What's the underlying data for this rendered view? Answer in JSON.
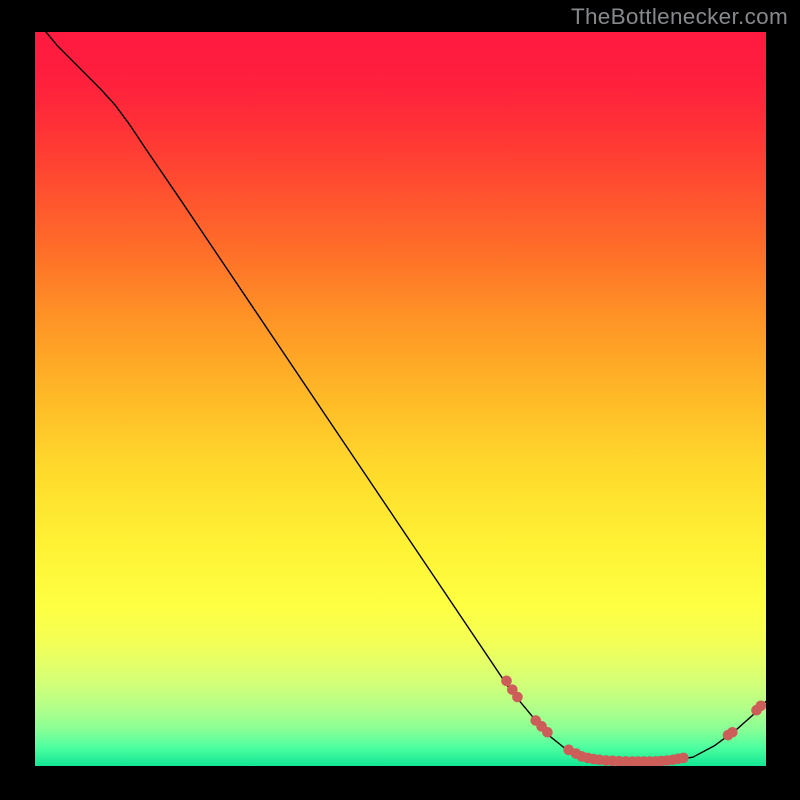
{
  "attribution": "TheBottlenecker.com",
  "chart_data": {
    "type": "line",
    "title": "",
    "xlabel": "",
    "ylabel": "",
    "xlim": [
      0,
      100
    ],
    "ylim": [
      0,
      100
    ],
    "background_gradient": {
      "stops": [
        {
          "offset": 0.0,
          "color": "#ff1a40"
        },
        {
          "offset": 0.06,
          "color": "#ff1e3e"
        },
        {
          "offset": 0.12,
          "color": "#ff2e38"
        },
        {
          "offset": 0.2,
          "color": "#ff4a30"
        },
        {
          "offset": 0.3,
          "color": "#ff6f29"
        },
        {
          "offset": 0.4,
          "color": "#ff9726"
        },
        {
          "offset": 0.5,
          "color": "#ffba27"
        },
        {
          "offset": 0.6,
          "color": "#ffdb2c"
        },
        {
          "offset": 0.7,
          "color": "#fff235"
        },
        {
          "offset": 0.78,
          "color": "#feff41"
        },
        {
          "offset": 0.83,
          "color": "#f4ff55"
        },
        {
          "offset": 0.86,
          "color": "#e4ff68"
        },
        {
          "offset": 0.89,
          "color": "#d0ff79"
        },
        {
          "offset": 0.92,
          "color": "#b3ff89"
        },
        {
          "offset": 0.95,
          "color": "#89ff95"
        },
        {
          "offset": 0.975,
          "color": "#4dffa0"
        },
        {
          "offset": 1.0,
          "color": "#12e695"
        }
      ]
    },
    "curve": {
      "color": "#000000",
      "width": 1.4,
      "points": [
        {
          "x": 1.5,
          "y": 100.0
        },
        {
          "x": 3.0,
          "y": 98.2
        },
        {
          "x": 6.0,
          "y": 95.2
        },
        {
          "x": 9.0,
          "y": 92.2
        },
        {
          "x": 11.0,
          "y": 90.0
        },
        {
          "x": 13.0,
          "y": 87.3
        },
        {
          "x": 15.0,
          "y": 84.3
        },
        {
          "x": 20.0,
          "y": 77.0
        },
        {
          "x": 25.0,
          "y": 69.6
        },
        {
          "x": 30.0,
          "y": 62.2
        },
        {
          "x": 35.0,
          "y": 54.8
        },
        {
          "x": 40.0,
          "y": 47.4
        },
        {
          "x": 45.0,
          "y": 40.0
        },
        {
          "x": 50.0,
          "y": 32.6
        },
        {
          "x": 55.0,
          "y": 25.2
        },
        {
          "x": 60.0,
          "y": 17.8
        },
        {
          "x": 65.0,
          "y": 10.4
        },
        {
          "x": 70.0,
          "y": 4.4
        },
        {
          "x": 72.5,
          "y": 2.4
        },
        {
          "x": 75.0,
          "y": 1.2
        },
        {
          "x": 78.0,
          "y": 0.6
        },
        {
          "x": 82.0,
          "y": 0.6
        },
        {
          "x": 86.0,
          "y": 0.6
        },
        {
          "x": 90.0,
          "y": 1.2
        },
        {
          "x": 93.0,
          "y": 2.8
        },
        {
          "x": 96.0,
          "y": 5.0
        },
        {
          "x": 98.5,
          "y": 7.2
        },
        {
          "x": 100.0,
          "y": 8.8
        }
      ]
    },
    "markers": {
      "color": "#cd5d58",
      "radius": 5.3,
      "points": [
        {
          "x": 64.5,
          "y": 11.6
        },
        {
          "x": 65.3,
          "y": 10.4
        },
        {
          "x": 66.0,
          "y": 9.4
        },
        {
          "x": 68.5,
          "y": 6.2
        },
        {
          "x": 69.3,
          "y": 5.4
        },
        {
          "x": 70.1,
          "y": 4.6
        },
        {
          "x": 73.0,
          "y": 2.2
        },
        {
          "x": 74.0,
          "y": 1.7
        },
        {
          "x": 74.8,
          "y": 1.3
        },
        {
          "x": 75.6,
          "y": 1.1
        },
        {
          "x": 76.4,
          "y": 0.95
        },
        {
          "x": 77.2,
          "y": 0.85
        },
        {
          "x": 78.1,
          "y": 0.75
        },
        {
          "x": 79.0,
          "y": 0.7
        },
        {
          "x": 79.9,
          "y": 0.65
        },
        {
          "x": 80.8,
          "y": 0.62
        },
        {
          "x": 81.7,
          "y": 0.6
        },
        {
          "x": 82.5,
          "y": 0.6
        },
        {
          "x": 83.3,
          "y": 0.6
        },
        {
          "x": 84.1,
          "y": 0.6
        },
        {
          "x": 84.9,
          "y": 0.63
        },
        {
          "x": 85.7,
          "y": 0.68
        },
        {
          "x": 86.5,
          "y": 0.75
        },
        {
          "x": 87.3,
          "y": 0.85
        },
        {
          "x": 88.0,
          "y": 0.98
        },
        {
          "x": 88.7,
          "y": 1.1
        },
        {
          "x": 94.8,
          "y": 4.2
        },
        {
          "x": 95.4,
          "y": 4.6
        },
        {
          "x": 98.7,
          "y": 7.6
        },
        {
          "x": 99.3,
          "y": 8.2
        }
      ]
    }
  }
}
